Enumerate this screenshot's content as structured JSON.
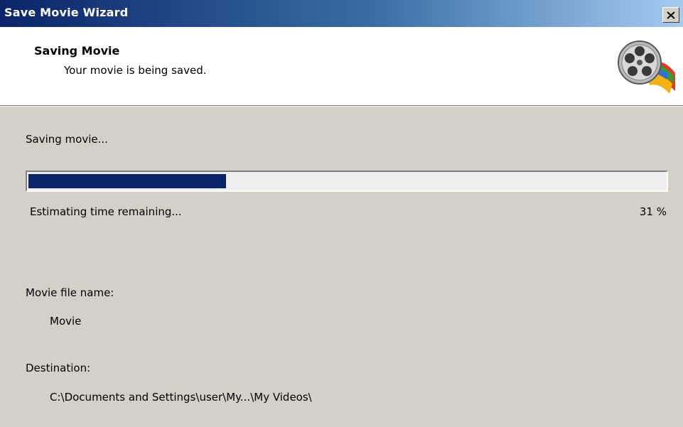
{
  "window": {
    "title": "Save Movie Wizard",
    "close_symbol": "close-icon"
  },
  "header": {
    "title": "Saving Movie",
    "subtitle": "Your movie is being saved.",
    "icon": "movie-maker-film-reel-icon"
  },
  "progress": {
    "status_text": "Saving movie...",
    "time_text": "Estimating time remaining...",
    "percent": 31,
    "percent_text": "31 %",
    "fill_color": "#0a246a"
  },
  "details": {
    "filename_caption": "Movie file name:",
    "filename_value": "Movie",
    "destination_caption": "Destination:",
    "destination_value": "C:\\Documents and Settings\\user\\My...\\My Videos\\"
  },
  "colors": {
    "title_gradient_start": "#0a246a",
    "title_gradient_end": "#a6caf0",
    "dialog_background": "#d4d0c8",
    "header_background": "#ffffff"
  }
}
